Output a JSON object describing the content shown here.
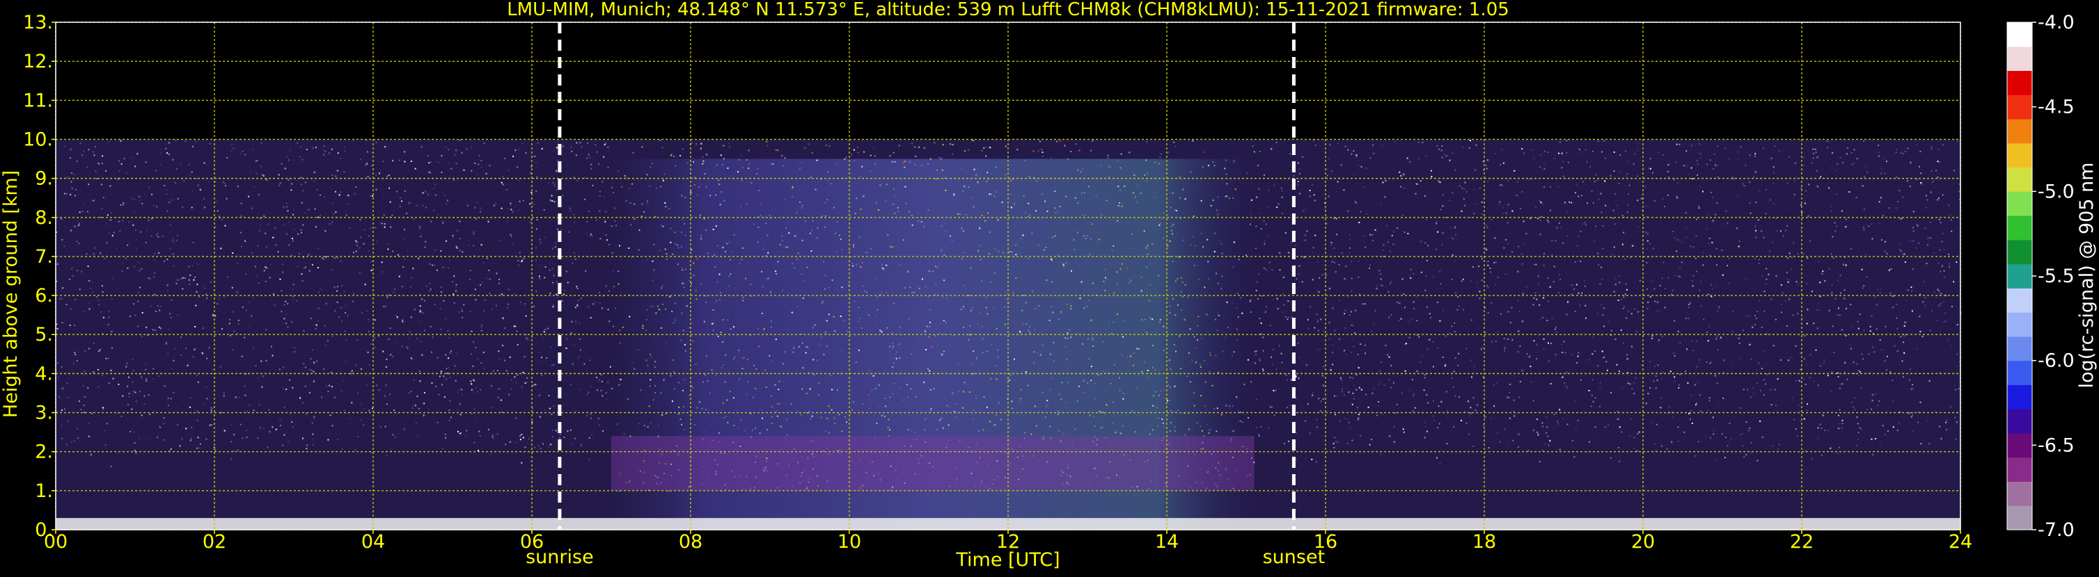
{
  "chart_data": {
    "type": "heatmap",
    "title": "LMU-MIM, Munich; 48.148° N 11.573° E, altitude: 539 m    Lufft CHM8k (CHM8kLMU): 15-11-2021    firmware: 1.05",
    "xlabel": "Time [UTC]",
    "ylabel": "Height above ground [km]",
    "xlim": [
      0,
      24
    ],
    "ylim": [
      0,
      13
    ],
    "x_ticks": [
      0,
      2,
      4,
      6,
      8,
      10,
      12,
      14,
      16,
      18,
      20,
      22,
      24
    ],
    "x_tick_labels": [
      "00",
      "02",
      "04",
      "06",
      "08",
      "10",
      "12",
      "14",
      "16",
      "18",
      "20",
      "22",
      "24"
    ],
    "y_ticks": [
      0,
      1,
      2,
      3,
      4,
      5,
      6,
      7,
      8,
      9,
      10,
      11,
      12,
      13
    ],
    "y_tick_labels": [
      "0.",
      "1.",
      "2.",
      "3.",
      "4.",
      "5.",
      "6.",
      "7.",
      "8.",
      "9.",
      "10.",
      "11.",
      "12.",
      "13."
    ],
    "grid": true,
    "data_top_km": 10,
    "events": [
      {
        "label": "sunrise",
        "time_utc": 6.35
      },
      {
        "label": "sunset",
        "time_utc": 15.6
      }
    ],
    "colorbar": {
      "label": "log(rc-signal) @ 905 nm",
      "range": [
        -7.0,
        -4.0
      ],
      "ticks": [
        -4.0,
        -4.5,
        -5.0,
        -5.5,
        -6.0,
        -6.5,
        -7.0
      ],
      "tick_labels": [
        "-4.0",
        "-4.5",
        "-5.0",
        "-5.5",
        "-6.0",
        "-6.5",
        "-7.0"
      ],
      "colors_bottom_to_top": [
        "#a898b0",
        "#a070a0",
        "#8a2a8a",
        "#6a0a7a",
        "#3a0aa0",
        "#1a1ae0",
        "#3a5af0",
        "#6a8af0",
        "#9ab0f8",
        "#c0d0fa",
        "#20a090",
        "#109030",
        "#30c030",
        "#80e050",
        "#d0e040",
        "#f0c020",
        "#f08010",
        "#f03010",
        "#e00000",
        "#f0d8dc",
        "#ffffff"
      ]
    },
    "signal_profile": {
      "description": "",
      "time_utc": [
        0,
        6,
        7,
        8,
        10,
        12,
        14,
        14.7,
        15.1,
        16,
        24
      ],
      "visible_top_km": [
        10,
        10,
        10,
        10,
        10,
        10,
        10,
        10,
        10,
        10,
        10
      ],
      "enhanced_layer_top_km": [
        0,
        0,
        8.5,
        9,
        9,
        9.5,
        10,
        9.5,
        0,
        0,
        0
      ]
    }
  }
}
